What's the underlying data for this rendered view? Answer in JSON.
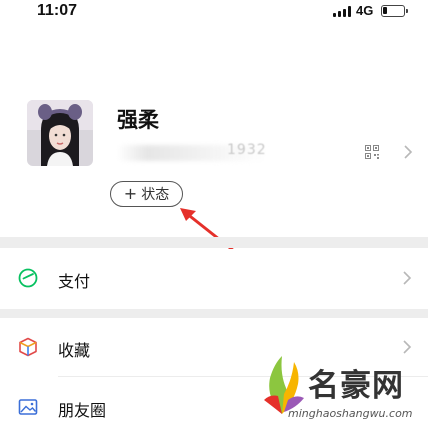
{
  "status_bar": {
    "time": "11:07",
    "network": "4G"
  },
  "profile": {
    "nickname": "强柔",
    "wechat_id_partial": "1932",
    "status_button_label": "状态",
    "status_button_plus": "+"
  },
  "menu": {
    "items": [
      {
        "label": "支付",
        "icon": "pay-icon"
      },
      {
        "label": "收藏",
        "icon": "favorites-icon"
      },
      {
        "label": "朋友圈",
        "icon": "moments-icon"
      }
    ]
  },
  "watermark": {
    "title": "名豪网",
    "url": "minghaoshangwu.com"
  },
  "colors": {
    "accent_green": "#07c160",
    "annotation_red": "#e5302a",
    "separator": "#ededed"
  }
}
